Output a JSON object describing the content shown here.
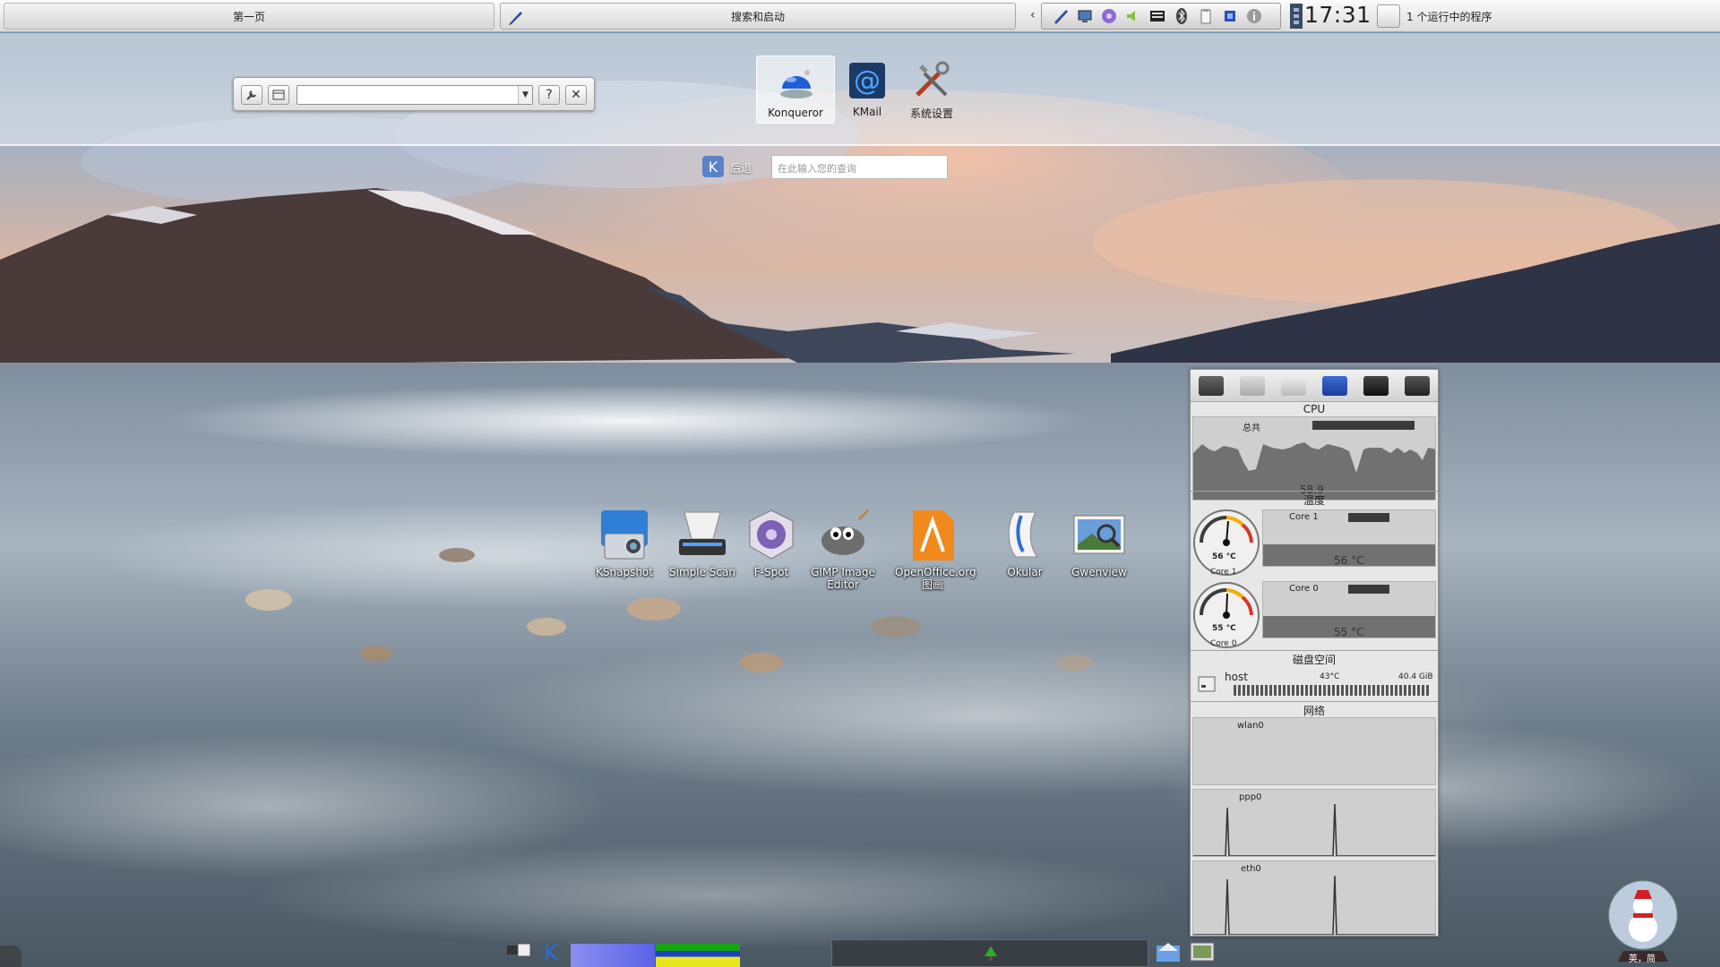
{
  "top_panel": {
    "pager_label": "第一页",
    "search_launch_label": "搜索和启动",
    "clock": "17:31",
    "running_programs": "1 个运行中的程序",
    "tray_icons": [
      "pen-icon",
      "network-icon",
      "media-icon",
      "volume-icon",
      "keyboard-icon",
      "bluetooth-icon",
      "clipboard-icon",
      "cpu-icon",
      "info-icon"
    ]
  },
  "dashboard": {
    "favorites": [
      {
        "label": "Konqueror",
        "icon": "konqueror-icon",
        "selected": true
      },
      {
        "label": "KMail",
        "icon": "kmail-icon"
      },
      {
        "label": "系统设置",
        "icon": "system-settings-icon"
      }
    ],
    "back_label": "后退",
    "query_placeholder": "在此输入您的查询",
    "toolbox_buttons": [
      "wrench-icon",
      "panel-icon",
      "help-icon",
      "close-icon"
    ],
    "help_glyph": "?",
    "close_glyph": "✕"
  },
  "desktop_icons": [
    {
      "label": "KSnapshot",
      "icon": "ksnapshot-icon"
    },
    {
      "label": "Simple Scan",
      "icon": "scanner-icon"
    },
    {
      "label": "F-Spot",
      "icon": "fspot-icon"
    },
    {
      "label": "GIMP Image Editor",
      "icon": "gimp-icon"
    },
    {
      "label": "OpenOffice.org 图画",
      "icon": "openoffice-draw-icon"
    },
    {
      "label": "Okular",
      "icon": "okular-icon"
    },
    {
      "label": "Gwenview",
      "icon": "gwenview-icon"
    }
  ],
  "system_monitor": {
    "cpu_title": "CPU",
    "cpu_total_label": "总共",
    "cpu_value": "58.9",
    "temp_title": "温度",
    "core1_label": "Core 1",
    "core1_value": "56 °C",
    "core1_gauge": "56 °C",
    "core1_gauge_label": "Core 1",
    "core0_label": "Core 0",
    "core0_value": "55 °C",
    "core0_gauge": "55 °C",
    "core0_gauge_label": "Core 0",
    "disk_title": "磁盘空间",
    "disk_host": "host",
    "disk_temp": "43°C",
    "disk_size": "40.4 GiB",
    "net_title": "网络",
    "net_wlan": "wlan0",
    "net_ppp": "ppp0",
    "net_eth": "eth0"
  },
  "bottom_panel": {
    "snow_globe_text": "英，简"
  }
}
